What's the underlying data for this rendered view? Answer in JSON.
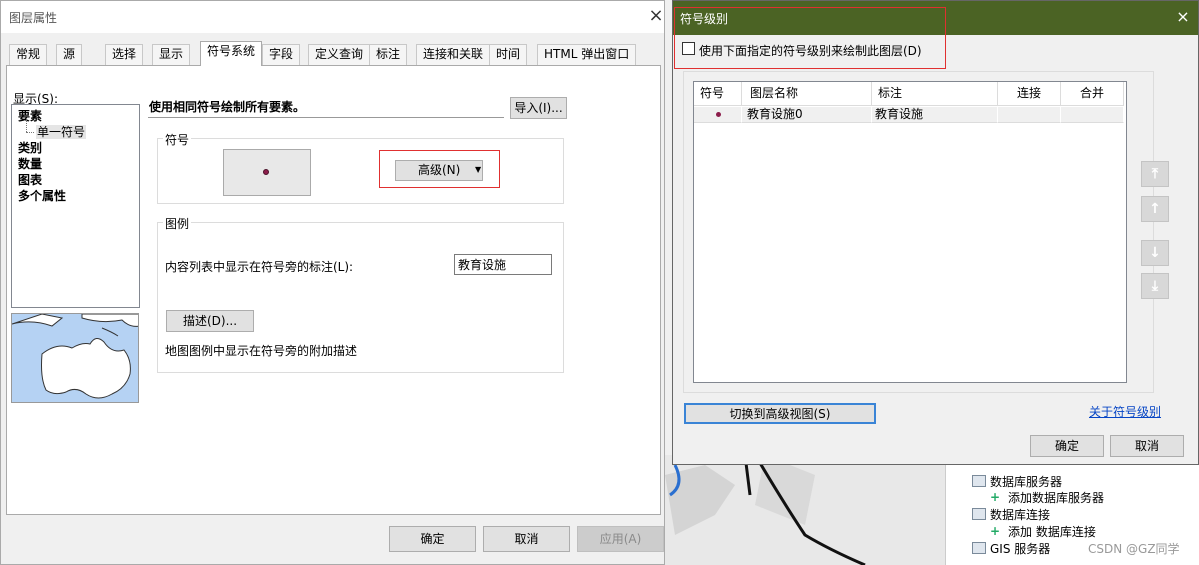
{
  "layer_dialog": {
    "title": "图层属性",
    "close": "×",
    "tabs": [
      "常规",
      "源",
      "选择",
      "显示",
      "符号系统",
      "字段",
      "定义查询",
      "标注",
      "连接和关联",
      "时间",
      "HTML 弹出窗口"
    ],
    "active_tab": "符号系统",
    "show_label": "显示(S):",
    "show_items": {
      "features": "要素",
      "single_symbol": "单一符号",
      "categories": "类别",
      "quantities": "数量",
      "charts": "图表",
      "multiple_attributes": "多个属性"
    },
    "description": "使用相同符号绘制所有要素。",
    "import_button": "导入(I)...",
    "symbol_group_label": "符号",
    "advanced_button": "高级(N)",
    "legend_group_label": "图例",
    "legend_text_label": "内容列表中显示在符号旁的标注(L):",
    "legend_text_value": "教育设施",
    "describe_button": "描述(D)...",
    "describe_hint": "地图图例中显示在符号旁的附加描述",
    "ok_button": "确定",
    "cancel_button": "取消",
    "apply_button": "应用(A)"
  },
  "symbol_levels_dialog": {
    "title": "符号级别",
    "close": "×",
    "use_levels_label": "使用下面指定的符号级别来绘制此图层(D)",
    "use_levels_checked": false,
    "columns": [
      "符号",
      "图层名称",
      "标注",
      "连接",
      "合并"
    ],
    "rows": [
      {
        "layer_name": "教育设施0",
        "label": "教育设施",
        "join": "",
        "merge": ""
      }
    ],
    "side_buttons": [
      "move-to-top-icon",
      "move-up-icon",
      "move-down-icon",
      "move-to-bottom-icon"
    ],
    "switch_view_button": "切换到高级视图(S)",
    "about_link": "关于符号级别",
    "ok_button": "确定",
    "cancel_button": "取消"
  },
  "catalog": {
    "items": [
      {
        "label": "数据库服务器",
        "indent": 0
      },
      {
        "label": "添加数据库服务器",
        "indent": 1
      },
      {
        "label": "数据库连接",
        "indent": 0
      },
      {
        "label": "添加 数据库连接",
        "indent": 1
      },
      {
        "label": "GIS 服务器",
        "indent": 0
      }
    ]
  },
  "watermark": "CSDN @GZ同学",
  "colors": {
    "levels_titlebar": "#4b6324",
    "highlight_box": "#e03030",
    "symbol_point": "#8c1d4b",
    "link": "#0645c5"
  }
}
